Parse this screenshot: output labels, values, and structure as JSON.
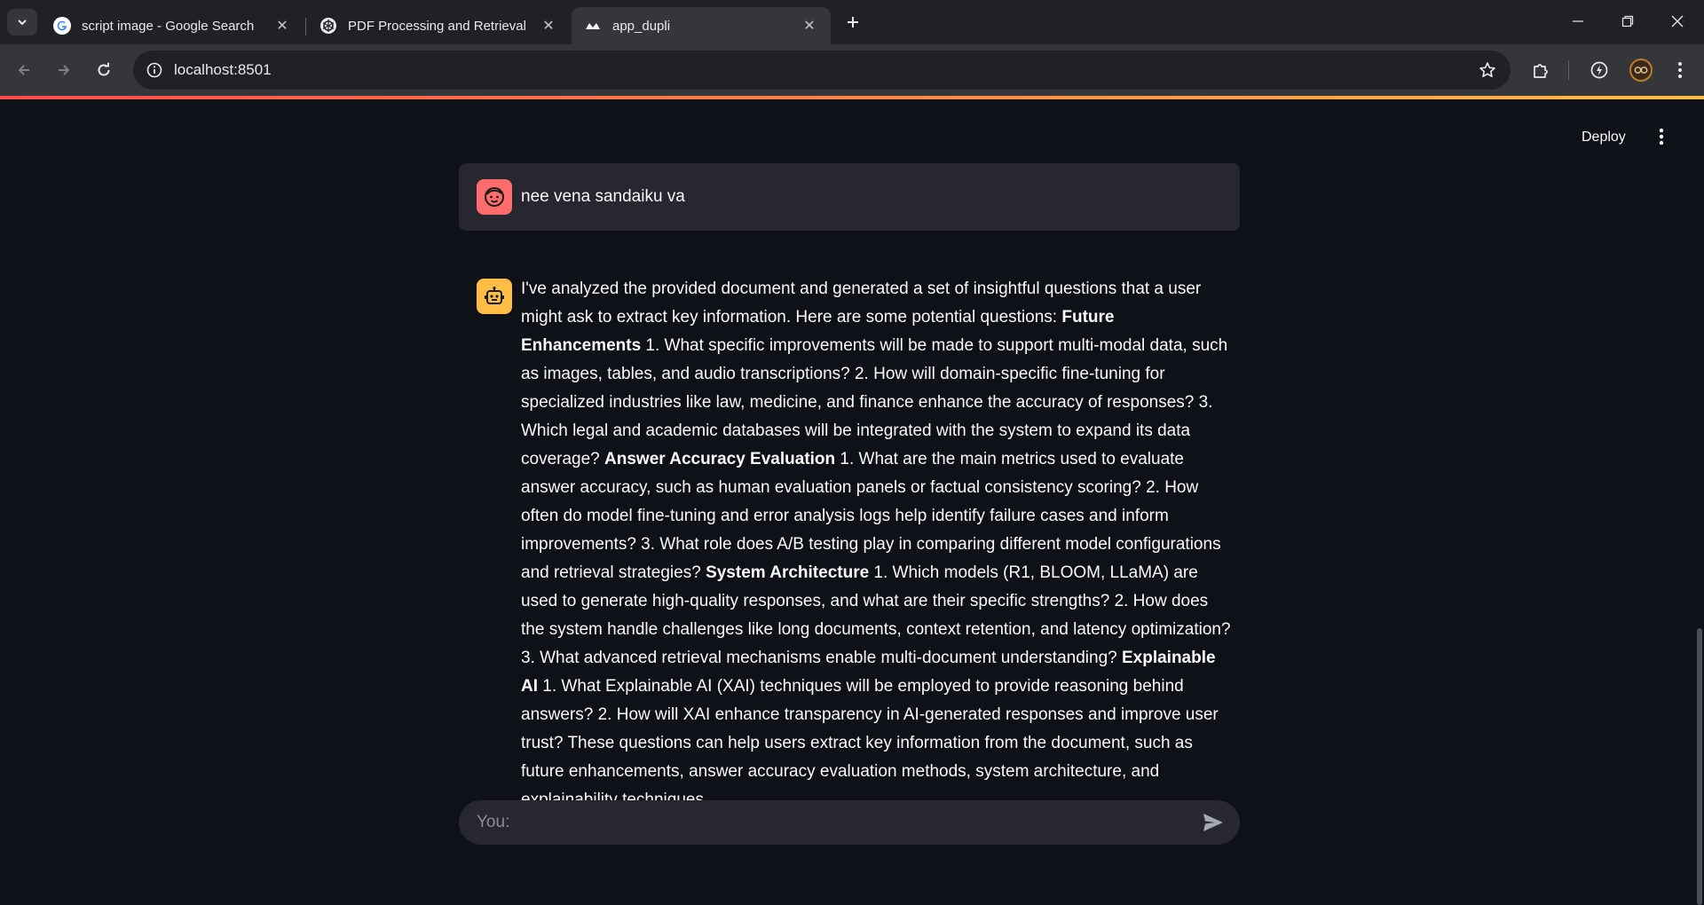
{
  "browser": {
    "tabs": [
      {
        "title": "script image - Google Search",
        "favicon": "google-icon",
        "active": false
      },
      {
        "title": "PDF Processing and Retrieval",
        "favicon": "openai-icon",
        "active": false
      },
      {
        "title": "app_dupli",
        "favicon": "streamlit-icon",
        "active": true
      }
    ],
    "url": "localhost:8501"
  },
  "app": {
    "deploy_label": "Deploy",
    "user_message": "nee vena sandaiku va",
    "bot_message": {
      "p1": "I've analyzed the provided document and generated a set of insightful questions that a user might ask to extract key information. Here are some potential questions: ",
      "h1": "Future Enhancements",
      "p2": " 1. What specific improvements will be made to support multi-modal data, such as images, tables, and audio transcriptions? 2. How will domain-specific fine-tuning for specialized industries like law, medicine, and finance enhance the accuracy of responses? 3. Which legal and academic databases will be integrated with the system to expand its data coverage? ",
      "h2": "Answer Accuracy Evaluation",
      "p3": " 1. What are the main metrics used to evaluate answer accuracy, such as human evaluation panels or factual consistency scoring? 2. How often do model fine-tuning and error analysis logs help identify failure cases and inform improvements? 3. What role does A/B testing play in comparing different model configurations and retrieval strategies? ",
      "h3": "System Architecture",
      "p4": " 1. Which models (R1, BLOOM, LLaMA) are used to generate high-quality responses, and what are their specific strengths? 2. How does the system handle challenges like long documents, context retention, and latency optimization? 3. What advanced retrieval mechanisms enable multi-document understanding? ",
      "h4": "Explainable AI",
      "p5": " 1. What Explainable AI (XAI) techniques will be employed to provide reasoning behind answers? 2. How will XAI enhance transparency in AI-generated responses and improve user trust? These questions can help users extract key information from the document, such as future enhancements, answer accuracy evaluation methods, system architecture, and explainability techniques."
    },
    "chat_input_placeholder": "You:"
  },
  "colors": {
    "background": "#0e1117",
    "user_avatar": "#ff6c6c",
    "bot_avatar": "#ffbd45",
    "message_bg": "#262730"
  }
}
